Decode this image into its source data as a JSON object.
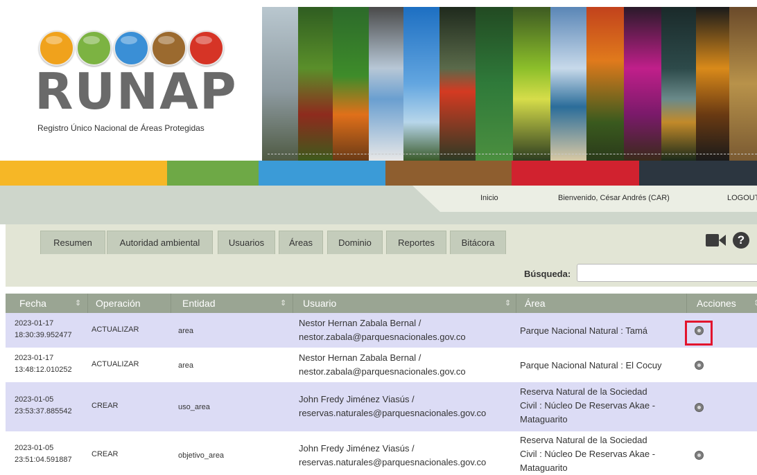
{
  "brand": {
    "logo_text": "RUNAP",
    "subtitle": "Registro Único Nacional de Áreas Protegidas",
    "logo_circle_colors": [
      "#f0a21c",
      "#7cb342",
      "#3a8fd6",
      "#9b6a2f",
      "#d63426"
    ]
  },
  "nav": {
    "inicio": "Inicio",
    "welcome": "Bienvenido, César Andrés (CAR)",
    "logout": "LOGOUT"
  },
  "tabs": [
    "Resumen",
    "Autoridad ambiental",
    "Usuarios",
    "Áreas",
    "Dominio",
    "Reportes",
    "Bitácora"
  ],
  "toolbar_icons": [
    "video-icon",
    "help-icon"
  ],
  "search": {
    "label": "Búsqueda:",
    "value": ""
  },
  "table": {
    "columns": [
      "Fecha",
      "Operación",
      "Entidad",
      "Usuario",
      "Área",
      "Acciones"
    ],
    "rows": [
      {
        "fecha": [
          "2023-01-17",
          "18:30:39.952477"
        ],
        "operacion": "ACTUALIZAR",
        "entidad": "area",
        "usuario": [
          "Nestor Hernan Zabala Bernal /",
          "nestor.zabala@parquesnacionales.gov.co"
        ],
        "area": [
          "Parque Nacional Natural : Tamá"
        ],
        "action_highlighted": true
      },
      {
        "fecha": [
          "2023-01-17",
          "13:48:12.010252"
        ],
        "operacion": "ACTUALIZAR",
        "entidad": "area",
        "usuario": [
          "Nestor Hernan Zabala Bernal /",
          "nestor.zabala@parquesnacionales.gov.co"
        ],
        "area": [
          "Parque Nacional Natural : El Cocuy"
        ],
        "action_highlighted": false
      },
      {
        "fecha": [
          "2023-01-05",
          "23:53:37.885542"
        ],
        "operacion": "CREAR",
        "entidad": "uso_area",
        "usuario": [
          "John Fredy Jiménez Viasús /",
          "reservas.naturales@parquesnacionales.gov.co"
        ],
        "area": [
          "Reserva Natural de la Sociedad",
          "Civil : Núcleo De Reservas Akae -",
          "Mataguarito"
        ],
        "action_highlighted": false
      },
      {
        "fecha": [
          "2023-01-05",
          "23:51:04.591887"
        ],
        "operacion": "CREAR",
        "entidad": "objetivo_area",
        "usuario": [
          "John Fredy Jiménez Viasús /",
          "reservas.naturales@parquesnacionales.gov.co"
        ],
        "area": [
          "Reserva Natural de la Sociedad",
          "Civil : Núcleo De Reservas Akae -",
          "Mataguarito"
        ],
        "action_highlighted": false
      }
    ]
  },
  "colors": {
    "color_bar": [
      "#f6b726",
      "#6ea946",
      "#3b9bd7",
      "#8e5e2f",
      "#d1222f",
      "#2c3640"
    ],
    "row_alt": "#dcdcf5",
    "header_bg": "#9aa593",
    "highlight": "#e2142d"
  }
}
